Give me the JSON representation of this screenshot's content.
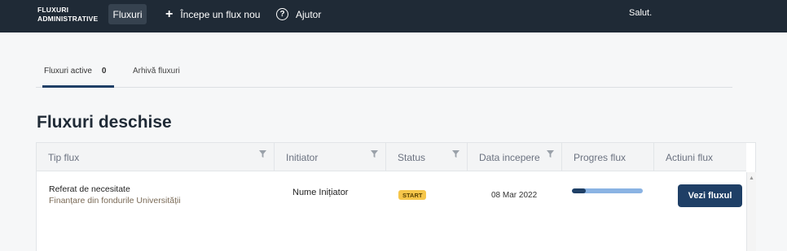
{
  "header": {
    "brand_line1": "FLUXURI",
    "brand_line2": "ADMINISTRATIVE",
    "nav": {
      "fluxuri": "Fluxuri",
      "new_flow": "Începe un flux nou",
      "help": "Ajutor"
    },
    "greeting": "Salut."
  },
  "tabs": {
    "active_label": "Fluxuri active",
    "active_count": "0",
    "archive_label": "Arhivă fluxuri"
  },
  "section_title": "Fluxuri deschise",
  "table": {
    "columns": [
      "Tip flux",
      "Initiator",
      "Status",
      "Data incepere",
      "Progres flux",
      "Actiuni flux"
    ],
    "rows": [
      {
        "type_title": "Referat de necesitate",
        "type_subtitle": "Finanțare din fondurile Universității",
        "initiator": "Nume Inițiator",
        "status": "START",
        "date": "08 Mar 2022",
        "progress": 0.2,
        "action_label": "Vezi fluxul"
      }
    ]
  },
  "colors": {
    "topbar": "#1f2a36",
    "accent": "#1f3f66",
    "status_start": "#f6c64a",
    "progress_track": "#8ab3e3"
  },
  "icons": {
    "add": "plus-icon",
    "help": "question-circle-icon",
    "filter": "filter-icon",
    "scroll": "scroll-up-arrow-icon"
  }
}
